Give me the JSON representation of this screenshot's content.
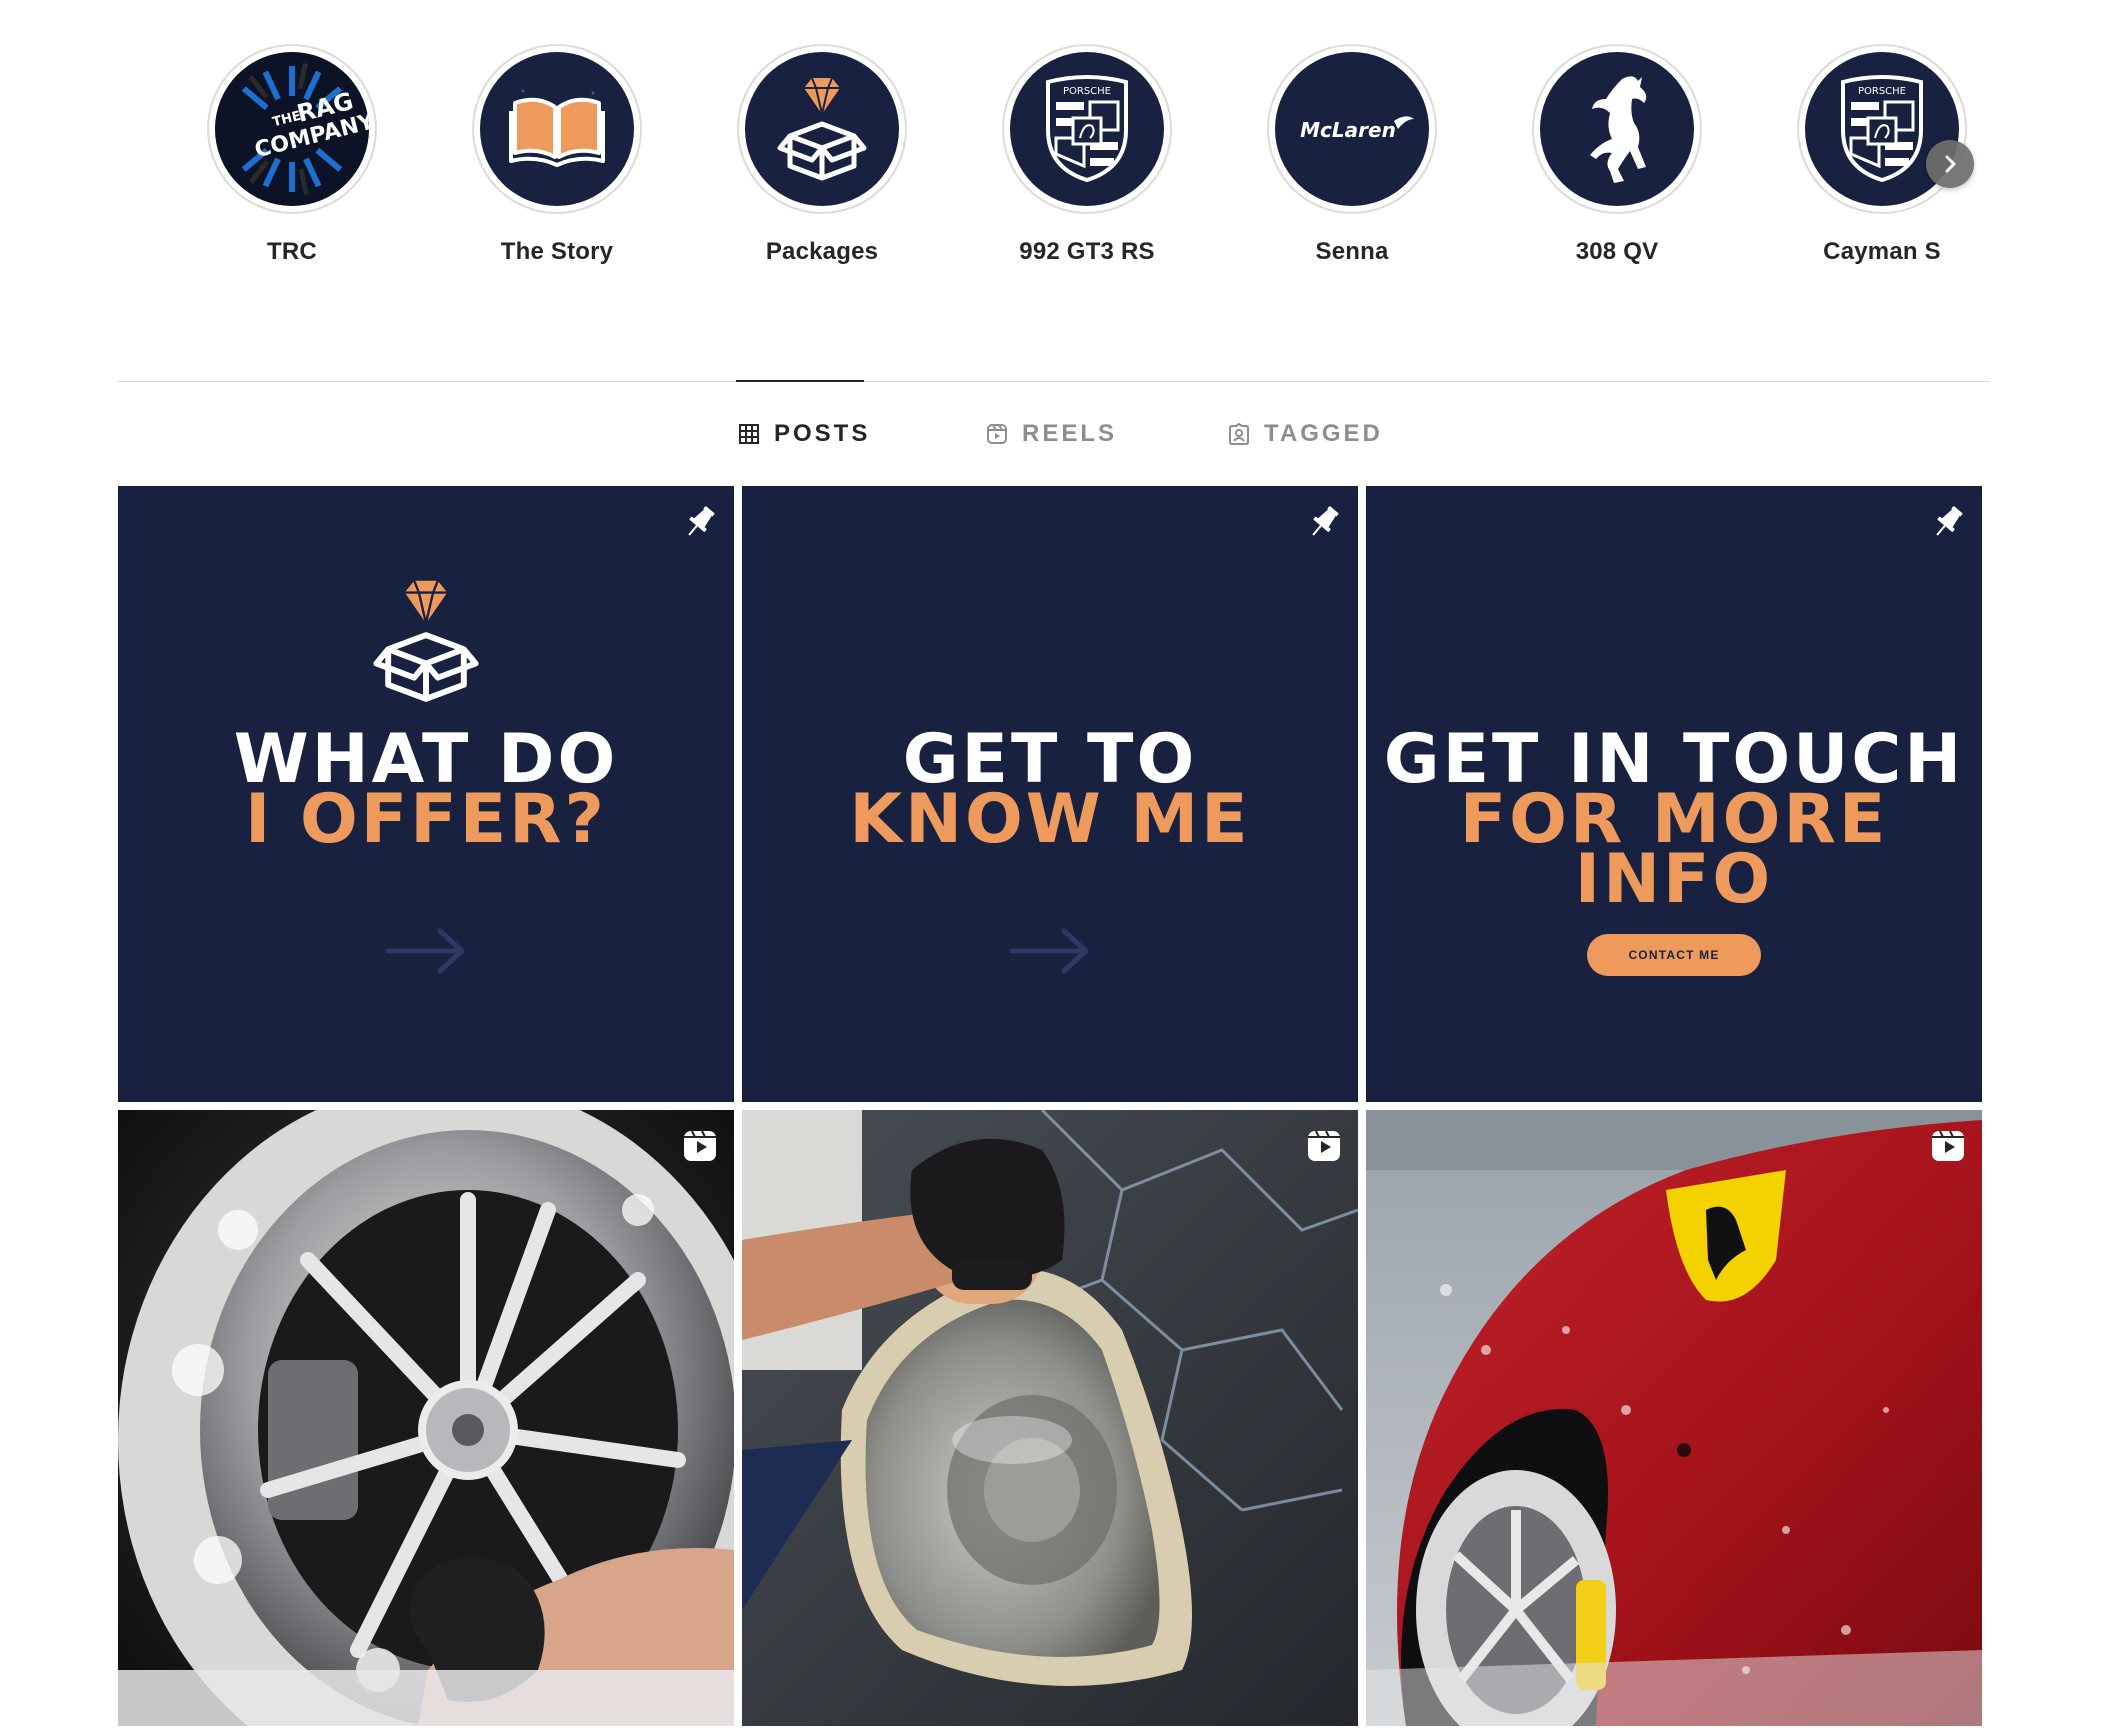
{
  "highlights": [
    {
      "label": "TRC",
      "icon": "rag-company-logo",
      "logo_text": [
        "THE",
        "RAG",
        "COMPANY"
      ]
    },
    {
      "label": "The Story",
      "icon": "open-book-icon"
    },
    {
      "label": "Packages",
      "icon": "diamond-box-icon"
    },
    {
      "label": "992 GT3 RS",
      "icon": "porsche-crest-icon",
      "logo_text": "PORSCHE"
    },
    {
      "label": "Senna",
      "icon": "mclaren-logo",
      "logo_text": "McLaren"
    },
    {
      "label": "308 QV",
      "icon": "prancing-horse-icon"
    },
    {
      "label": "Cayman S",
      "icon": "porsche-crest-icon",
      "logo_text": "PORSCHE"
    }
  ],
  "tabs": [
    {
      "label": "POSTS",
      "icon": "grid-icon",
      "active": true
    },
    {
      "label": "REELS",
      "icon": "reels-icon",
      "active": false
    },
    {
      "label": "TAGGED",
      "icon": "tagged-icon",
      "active": false
    }
  ],
  "posts": [
    {
      "type": "pinned",
      "icon": "pin-icon",
      "line1": "WHAT DO",
      "line2": "I OFFER?",
      "graphic": "diamond-box-icon",
      "footer": "arrow-right-icon"
    },
    {
      "type": "pinned",
      "icon": "pin-icon",
      "line1": "GET TO",
      "line2": "KNOW ME",
      "footer": "arrow-right-icon"
    },
    {
      "type": "pinned",
      "icon": "pin-icon",
      "line1": "GET IN TOUCH",
      "line2": "FOR MORE INFO",
      "button": "CONTACT ME"
    },
    {
      "type": "reel",
      "icon": "reel-icon",
      "subject": "foamy chrome wheel being washed"
    },
    {
      "type": "reel",
      "icon": "reel-icon",
      "subject": "headlight being polished"
    },
    {
      "type": "reel",
      "icon": "reel-icon",
      "subject": "red Ferrari fender with foam"
    }
  ],
  "colors": {
    "navy": "#182240",
    "orange": "#ee9a5c",
    "text": "#262626",
    "muted": "#8e8e8e",
    "divider": "#dbdbdb"
  }
}
